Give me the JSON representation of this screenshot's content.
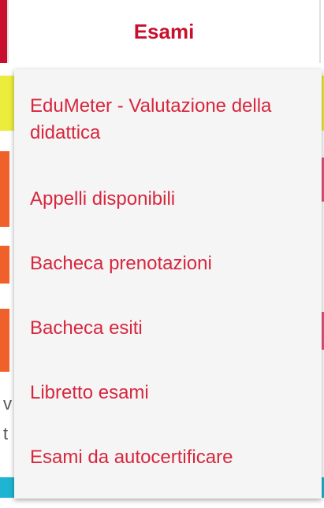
{
  "header": {
    "title": "Esami"
  },
  "menu": {
    "items": [
      {
        "label": "EduMeter - Valutazione della didattica"
      },
      {
        "label": "Appelli disponibili"
      },
      {
        "label": "Bacheca prenotazioni"
      },
      {
        "label": "Bacheca esiti"
      },
      {
        "label": "Libretto esami"
      },
      {
        "label": "Esami da autocertificare"
      }
    ]
  },
  "background": {
    "fragment_1": "v",
    "fragment_2": "t"
  },
  "colors": {
    "accent": "#c8102e",
    "menu_text": "#d7263d",
    "menu_bg": "#f5f5f5",
    "bg_yellow": "#ecec3c",
    "bg_orange": "#f0602a",
    "bg_pink": "#e8537a",
    "bg_cyan": "#1fb4d2"
  }
}
